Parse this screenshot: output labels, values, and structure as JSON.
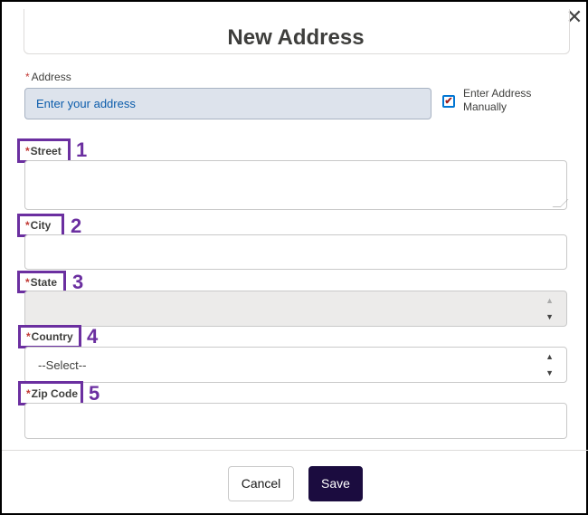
{
  "modal": {
    "title": "New Address",
    "close_icon": "close-icon"
  },
  "address": {
    "required_mark": "*",
    "label": "Address",
    "placeholder": "Enter your address",
    "value": ""
  },
  "manual_entry": {
    "checked": true,
    "label": "Enter Address Manually"
  },
  "fields": {
    "street": {
      "required_mark": "*",
      "label": "Street",
      "number": "1",
      "value": ""
    },
    "city": {
      "required_mark": "*",
      "label": "City",
      "number": "2",
      "value": ""
    },
    "state": {
      "required_mark": "*",
      "label": "State",
      "number": "3",
      "value": "",
      "disabled": true
    },
    "country": {
      "required_mark": "*",
      "label": "Country",
      "number": "4",
      "selected": "--Select--"
    },
    "zip": {
      "required_mark": "*",
      "label": "Zip Code",
      "number": "5",
      "value": ""
    }
  },
  "footer": {
    "cancel_label": "Cancel",
    "save_label": "Save"
  },
  "colors": {
    "highlight": "#6b2fa0",
    "required": "#c23934",
    "save_bg": "#1b0c3f",
    "address_bg": "#dde3ec"
  },
  "icons": {
    "checkbox_check": "✔",
    "spinner_up": "▲",
    "spinner_down": "▼",
    "close": "✕"
  }
}
